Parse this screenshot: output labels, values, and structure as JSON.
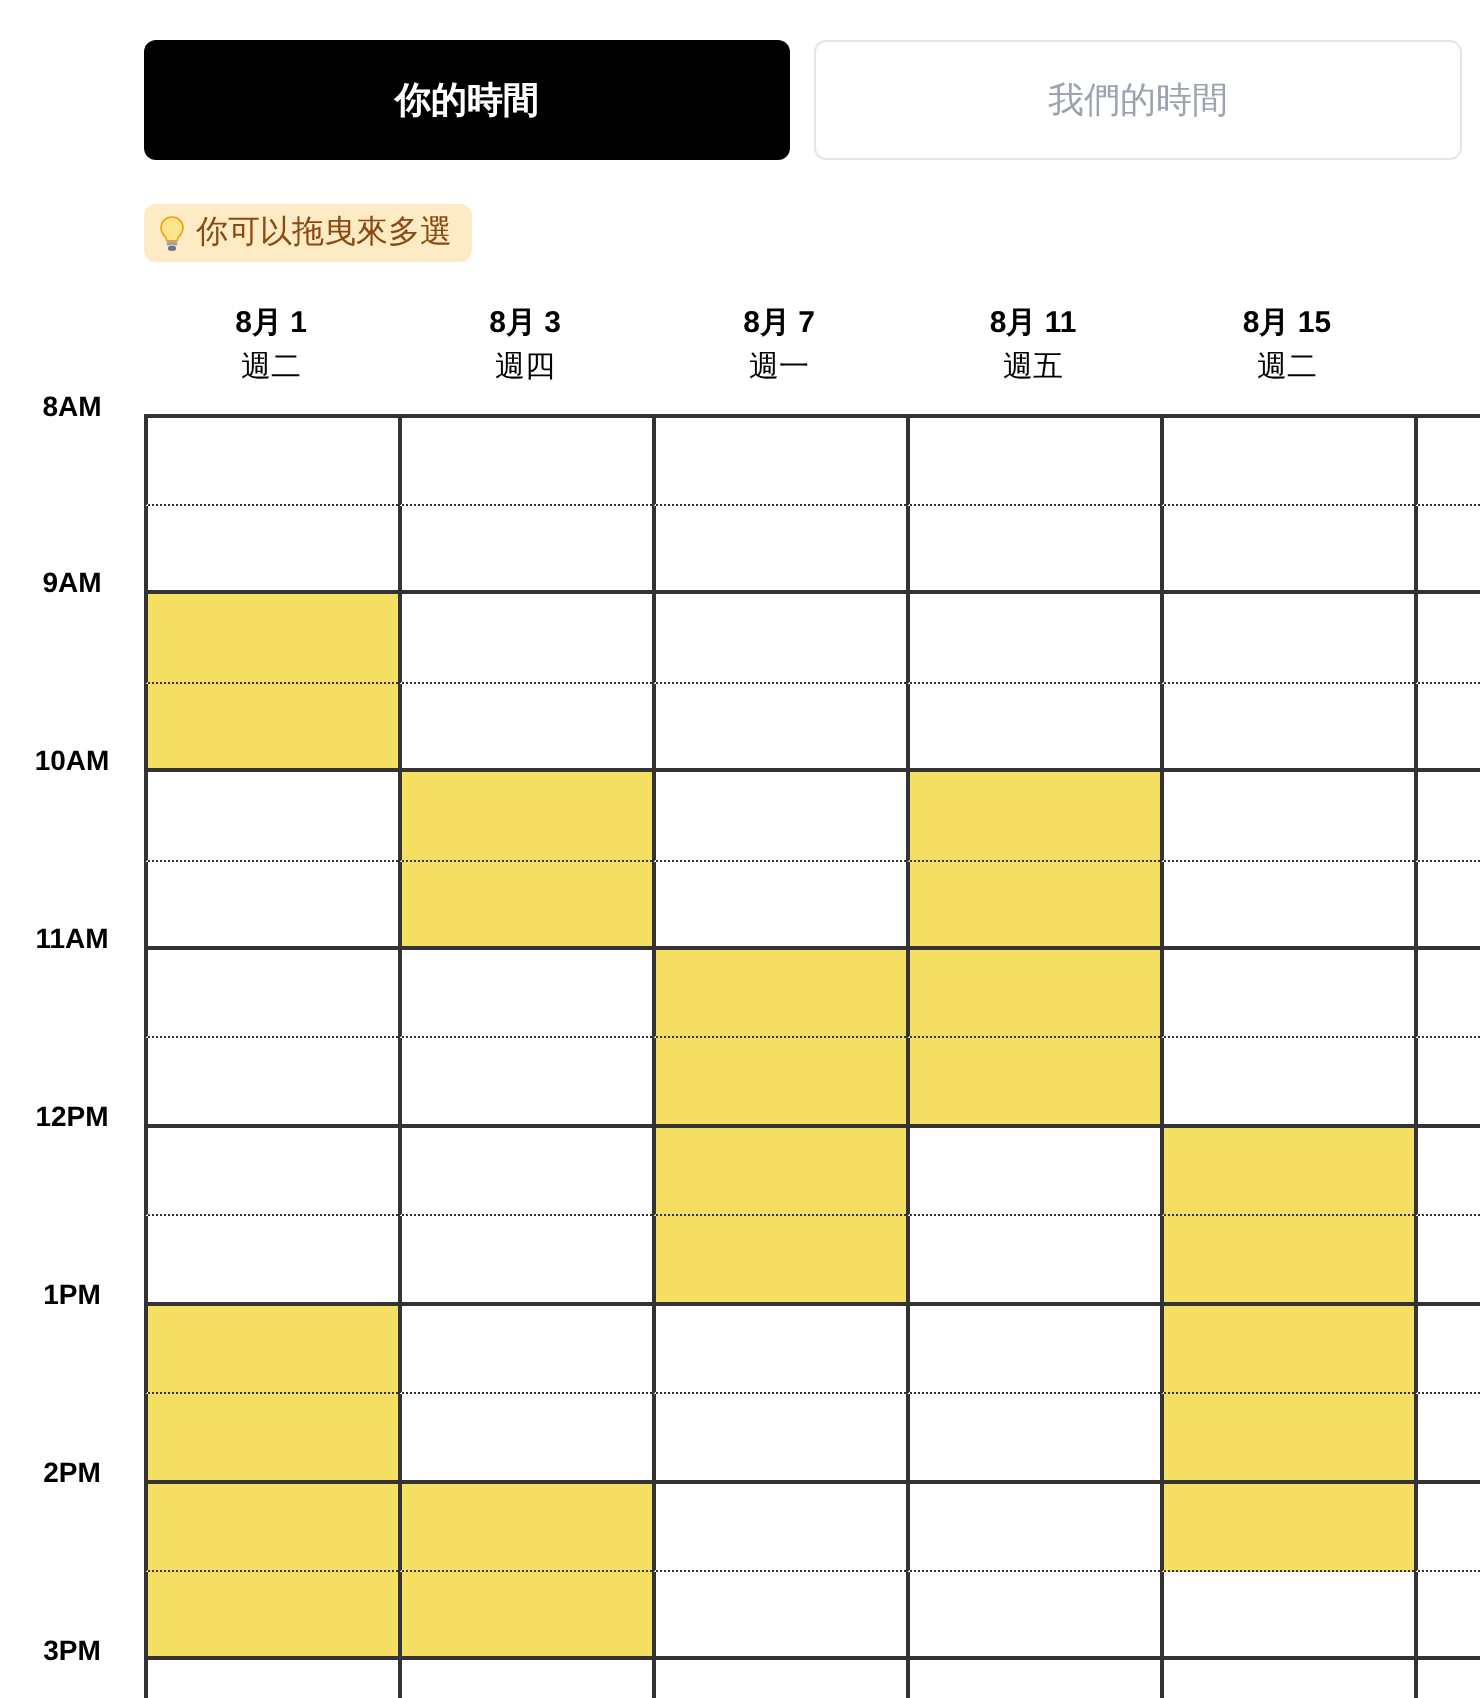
{
  "tabs": [
    {
      "label": "你的時間",
      "selected": true
    },
    {
      "label": "我們的時間",
      "selected": false
    }
  ],
  "hint": {
    "text": "你可以拖曳來多選"
  },
  "time_labels": [
    "8AM",
    "9AM",
    "10AM",
    "11AM",
    "12PM",
    "1PM",
    "2PM",
    "3PM"
  ],
  "days": [
    {
      "date": "8月 1",
      "weekday": "週二",
      "slots": [
        {
          "selected": false
        },
        {
          "selected": false
        },
        {
          "selected": true
        },
        {
          "selected": true
        },
        {
          "selected": false
        },
        {
          "selected": false
        },
        {
          "selected": false
        },
        {
          "selected": false
        },
        {
          "selected": false
        },
        {
          "selected": false
        },
        {
          "selected": true
        },
        {
          "selected": true
        },
        {
          "selected": true
        },
        {
          "selected": true
        },
        {
          "selected": false
        }
      ]
    },
    {
      "date": "8月 3",
      "weekday": "週四",
      "slots": [
        {
          "selected": false
        },
        {
          "selected": false
        },
        {
          "selected": false
        },
        {
          "selected": false
        },
        {
          "selected": true
        },
        {
          "selected": true
        },
        {
          "selected": false
        },
        {
          "selected": false
        },
        {
          "selected": false
        },
        {
          "selected": false
        },
        {
          "selected": false
        },
        {
          "selected": false
        },
        {
          "selected": true
        },
        {
          "selected": true
        },
        {
          "selected": false
        }
      ]
    },
    {
      "date": "8月 7",
      "weekday": "週一",
      "slots": [
        {
          "selected": false
        },
        {
          "selected": false
        },
        {
          "selected": false
        },
        {
          "selected": false
        },
        {
          "selected": false
        },
        {
          "selected": false
        },
        {
          "selected": true
        },
        {
          "selected": true
        },
        {
          "selected": true
        },
        {
          "selected": true
        },
        {
          "selected": false
        },
        {
          "selected": false
        },
        {
          "selected": false
        },
        {
          "selected": false
        },
        {
          "selected": false
        }
      ]
    },
    {
      "date": "8月 11",
      "weekday": "週五",
      "slots": [
        {
          "selected": false
        },
        {
          "selected": false
        },
        {
          "selected": false
        },
        {
          "selected": false
        },
        {
          "selected": true
        },
        {
          "selected": true
        },
        {
          "selected": true
        },
        {
          "selected": true
        },
        {
          "selected": false
        },
        {
          "selected": false
        },
        {
          "selected": false
        },
        {
          "selected": false
        },
        {
          "selected": false
        },
        {
          "selected": false
        },
        {
          "selected": false
        }
      ]
    },
    {
      "date": "8月 15",
      "weekday": "週二",
      "slots": [
        {
          "selected": false
        },
        {
          "selected": false
        },
        {
          "selected": false
        },
        {
          "selected": false
        },
        {
          "selected": false
        },
        {
          "selected": false
        },
        {
          "selected": false
        },
        {
          "selected": false
        },
        {
          "selected": true
        },
        {
          "selected": true
        },
        {
          "selected": true
        },
        {
          "selected": true
        },
        {
          "selected": true
        },
        {
          "selected": false
        },
        {
          "selected": false
        }
      ]
    },
    {
      "slots": [
        {
          "selected": false
        },
        {
          "selected": false
        },
        {
          "selected": false
        },
        {
          "selected": false
        },
        {
          "selected": false
        },
        {
          "selected": false
        },
        {
          "selected": false
        },
        {
          "selected": false
        },
        {
          "selected": false
        },
        {
          "selected": false
        },
        {
          "selected": false
        },
        {
          "selected": false
        },
        {
          "selected": false
        },
        {
          "selected": false
        },
        {
          "selected": false
        }
      ]
    }
  ]
}
